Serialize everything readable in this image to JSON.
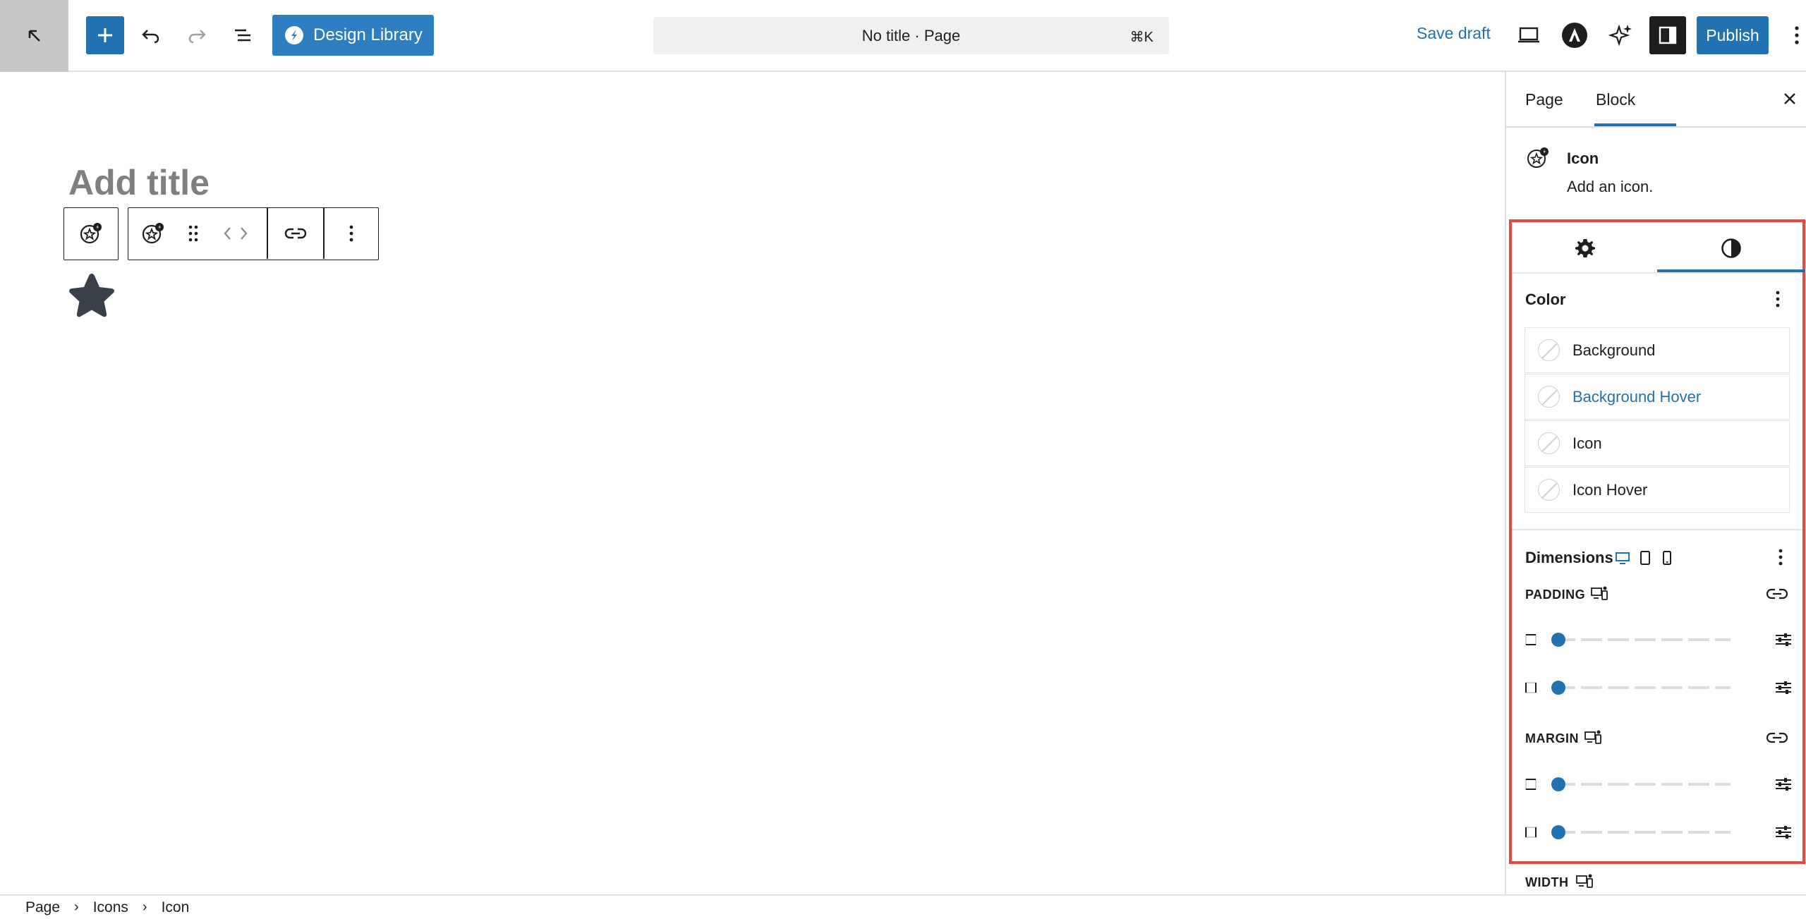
{
  "header": {
    "design_library_label": "Design Library",
    "command": {
      "title": "No title · Page",
      "shortcut": "⌘K"
    },
    "save_draft_label": "Save draft",
    "publish_label": "Publish"
  },
  "canvas": {
    "title_placeholder": "Add title",
    "block_icon": "star-icon"
  },
  "sidebar": {
    "tabs": [
      {
        "label": "Page",
        "active": false
      },
      {
        "label": "Block",
        "active": true
      }
    ],
    "block": {
      "name": "Icon",
      "description": "Add an icon."
    },
    "inspector_tabs": [
      "gear-icon",
      "half-circle-contrast-icon"
    ],
    "color": {
      "title": "Color",
      "items": [
        {
          "label": "Background",
          "highlighted": false
        },
        {
          "label": "Background Hover",
          "highlighted": true
        },
        {
          "label": "Icon",
          "highlighted": false
        },
        {
          "label": "Icon Hover",
          "highlighted": false
        }
      ]
    },
    "dimensions": {
      "title": "Dimensions",
      "padding_label": "PADDING",
      "margin_label": "MARGIN",
      "width_label": "WIDTH",
      "slider_value": 0
    }
  },
  "breadcrumb": [
    "Page",
    "Icons",
    "Icon"
  ],
  "colors": {
    "accent": "#2271b1",
    "highlight_frame": "#e44a44",
    "star": "#3a4049"
  }
}
